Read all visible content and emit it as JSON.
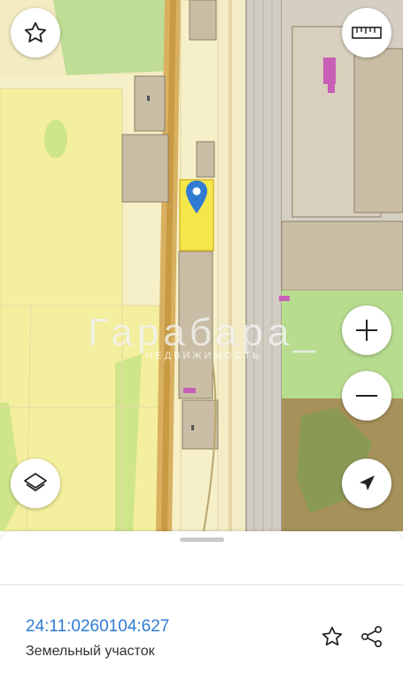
{
  "map": {
    "watermark": "Гарабара_",
    "watermark_sub": "НЕДВИЖИМОСТЬ"
  },
  "controls": {
    "favorite": "star-icon",
    "ruler": "ruler-icon",
    "zoom_in": "plus-icon",
    "zoom_out": "minus-icon",
    "layers": "layers-icon",
    "locate": "navigation-arrow-icon"
  },
  "parcel": {
    "cadastral_number": "24:11:0260104:627",
    "type": "Земельный участок"
  },
  "colors": {
    "accent_blue": "#2f7bd3",
    "parcel_yellow": "#f5e74a",
    "land_beige": "#f6f0c8",
    "green_area": "#b7dc8e",
    "building": "#c9bea5"
  }
}
